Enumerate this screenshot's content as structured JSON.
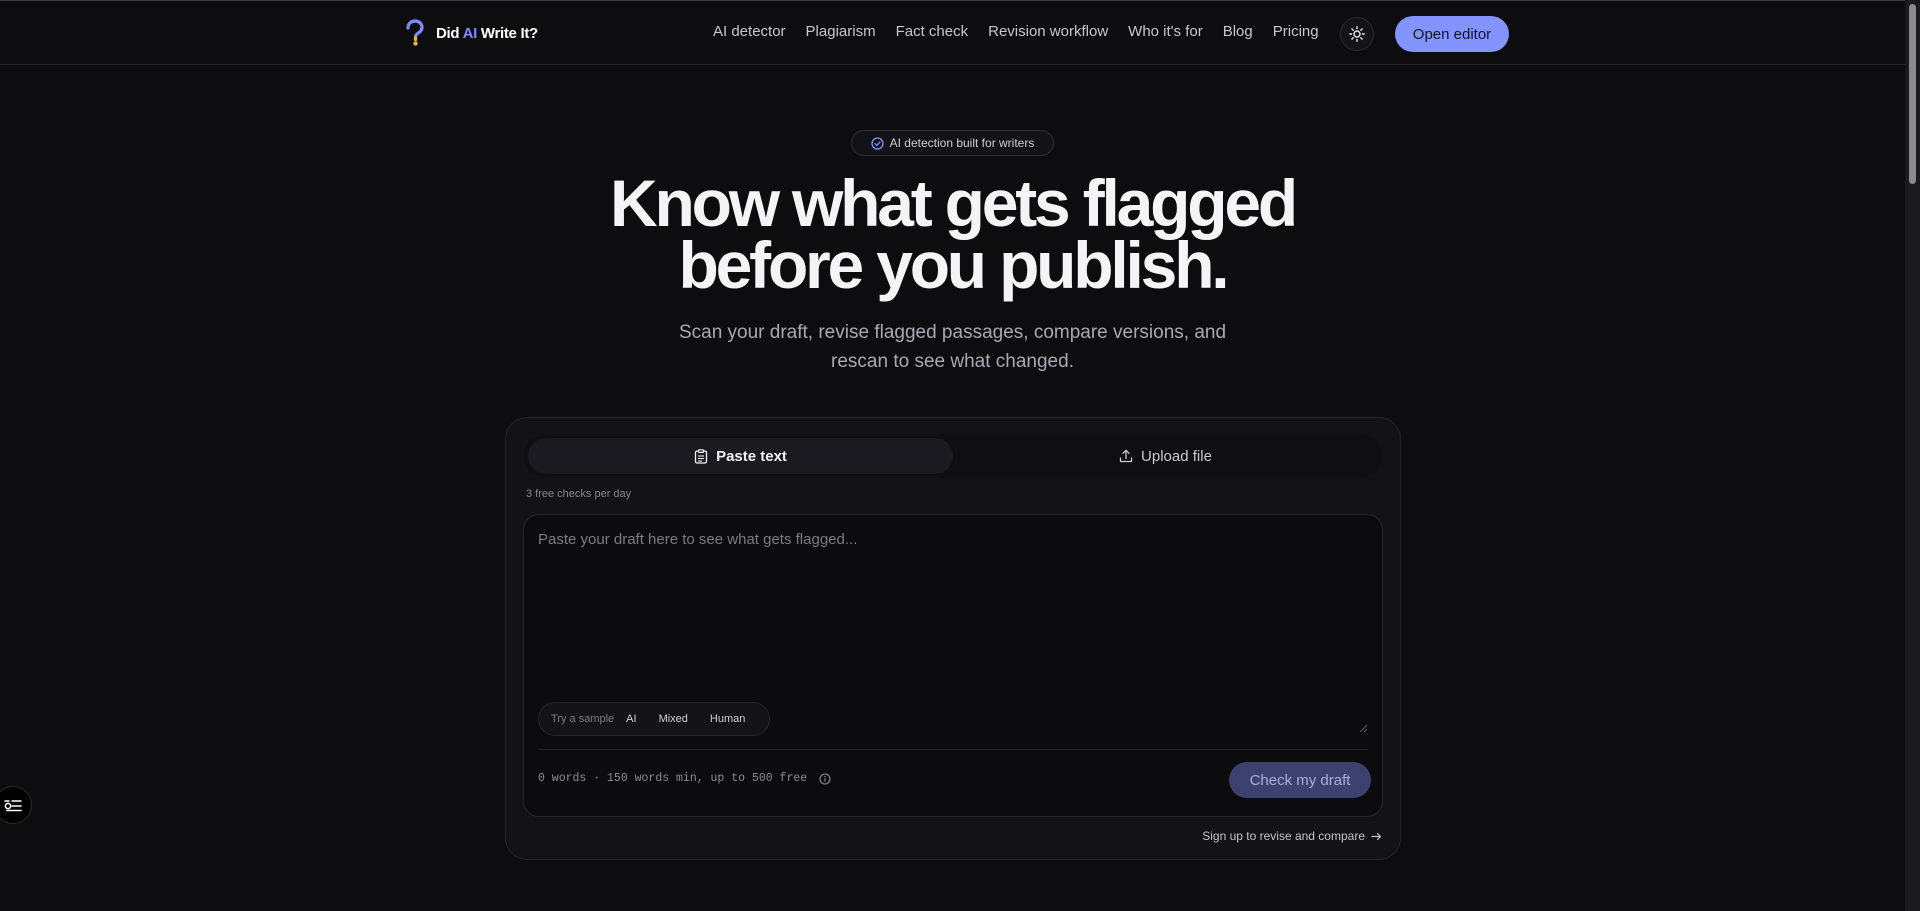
{
  "brand": {
    "name_prefix": "Did ",
    "name_ai": "AI",
    "name_suffix": " Write It?"
  },
  "nav": {
    "items": [
      "AI detector",
      "Plagiarism",
      "Fact check",
      "Revision workflow",
      "Who it's for",
      "Blog",
      "Pricing"
    ],
    "theme_icon": "sun-icon",
    "cta_label": "Open editor"
  },
  "hero": {
    "badge": "AI detection built for writers",
    "title_line1": "Know what gets flagged",
    "title_line2": "before you publish.",
    "subtitle": "Scan your draft, revise flagged passages, compare versions, and rescan to see what changed."
  },
  "checker": {
    "tabs": [
      {
        "label": "Paste text",
        "icon": "clipboard-icon",
        "active": true
      },
      {
        "label": "Upload file",
        "icon": "upload-icon",
        "active": false
      }
    ],
    "free_note": "3 free checks per day",
    "placeholder": "Paste your draft here to see what gets flagged...",
    "samples_label": "Try a sample",
    "samples": [
      "AI",
      "Mixed",
      "Human"
    ],
    "word_count": "0 words · 150 words min, up to 500 free",
    "check_label": "Check my draft",
    "signup_label": "Sign up to revise and compare"
  },
  "colors": {
    "background": "#0d0d10",
    "accent": "#8394ff",
    "accent_ai_text": "#7c8cff",
    "check_button": "#3d4170"
  }
}
